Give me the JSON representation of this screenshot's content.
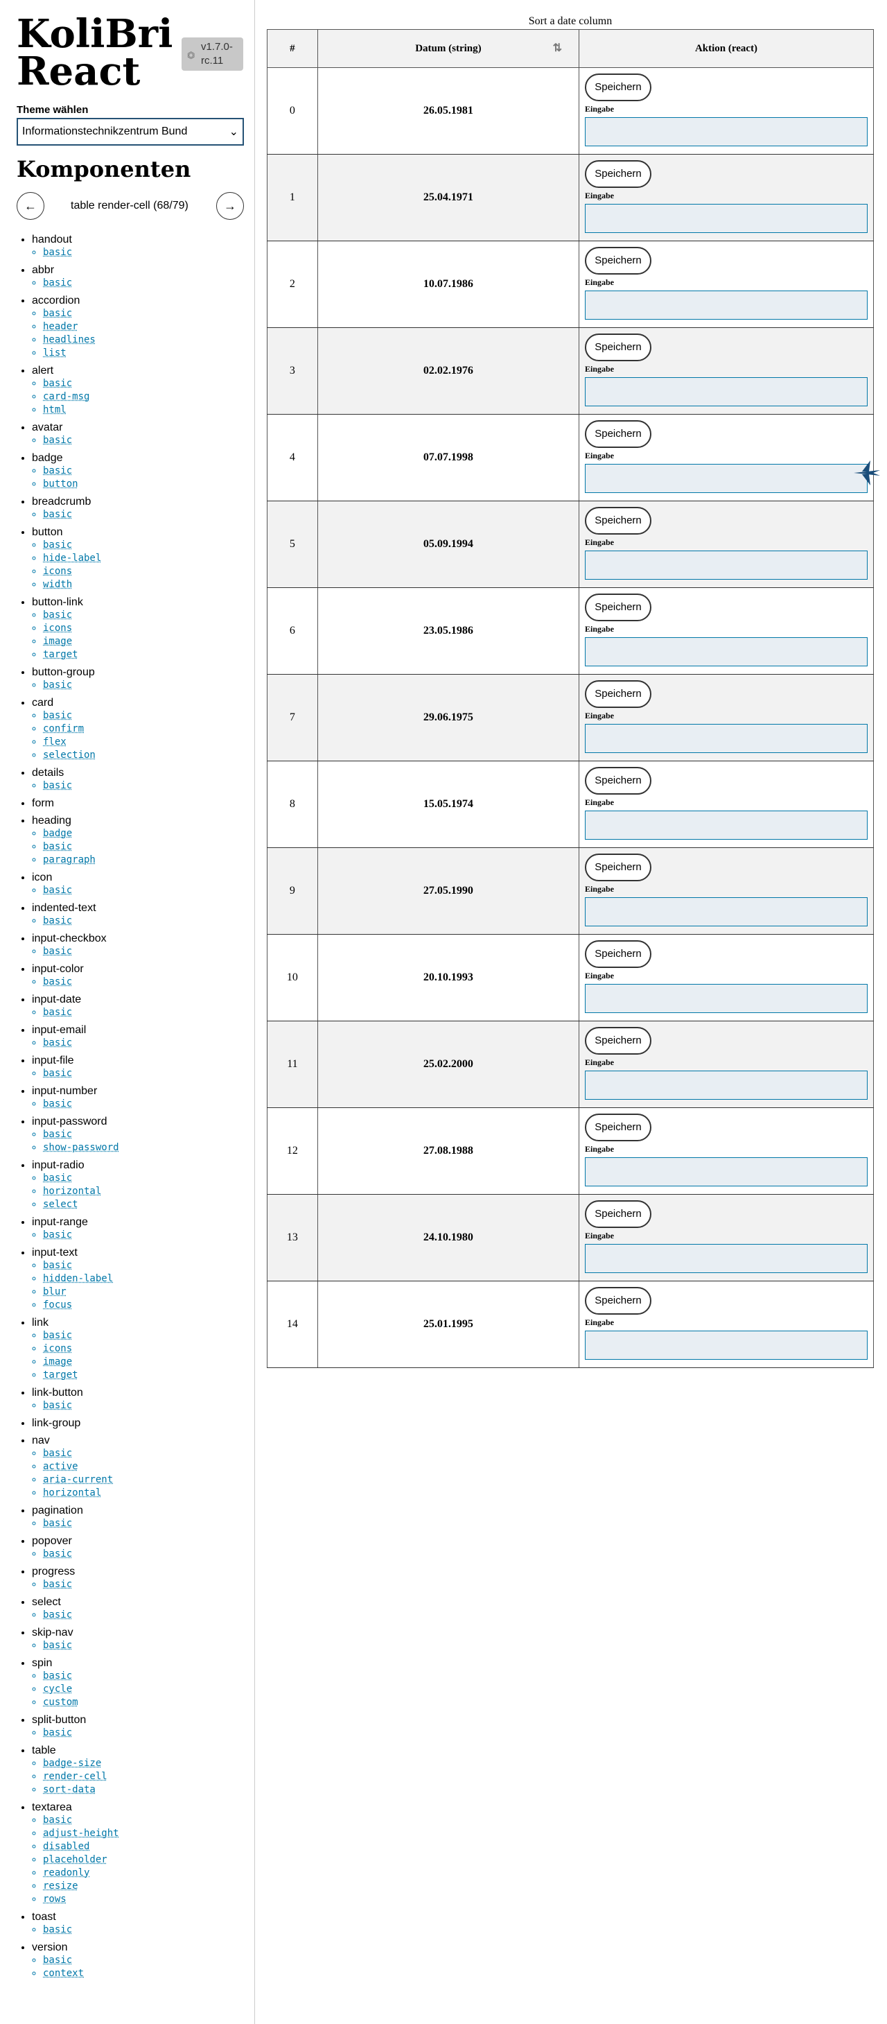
{
  "sidebar": {
    "logo_line1": "KoliBri",
    "logo_line2": "React",
    "version": "v1.7.0-rc.11",
    "theme_label": "Theme wählen",
    "theme_value": "Informationstechnikzentrum Bund",
    "components_heading": "Komponenten",
    "pager_label": "table render-cell (68/79)",
    "prev_icon": "arrow-left",
    "next_icon": "arrow-right",
    "components": [
      {
        "name": "handout",
        "links": [
          "basic"
        ]
      },
      {
        "name": "abbr",
        "links": [
          "basic"
        ]
      },
      {
        "name": "accordion",
        "links": [
          "basic",
          "header",
          "headlines",
          "list"
        ]
      },
      {
        "name": "alert",
        "links": [
          "basic",
          "card-msg",
          "html"
        ]
      },
      {
        "name": "avatar",
        "links": [
          "basic"
        ]
      },
      {
        "name": "badge",
        "links": [
          "basic",
          "button"
        ]
      },
      {
        "name": "breadcrumb",
        "links": [
          "basic"
        ]
      },
      {
        "name": "button",
        "links": [
          "basic",
          "hide-label",
          "icons",
          "width"
        ]
      },
      {
        "name": "button-link",
        "links": [
          "basic",
          "icons",
          "image",
          "target"
        ]
      },
      {
        "name": "button-group",
        "links": [
          "basic"
        ]
      },
      {
        "name": "card",
        "links": [
          "basic",
          "confirm",
          "flex",
          "selection"
        ]
      },
      {
        "name": "details",
        "links": [
          "basic"
        ]
      },
      {
        "name": "form",
        "links": []
      },
      {
        "name": "heading",
        "links": [
          "badge",
          "basic",
          "paragraph"
        ]
      },
      {
        "name": "icon",
        "links": [
          "basic"
        ]
      },
      {
        "name": "indented-text",
        "links": [
          "basic"
        ]
      },
      {
        "name": "input-checkbox",
        "links": [
          "basic"
        ]
      },
      {
        "name": "input-color",
        "links": [
          "basic"
        ]
      },
      {
        "name": "input-date",
        "links": [
          "basic"
        ]
      },
      {
        "name": "input-email",
        "links": [
          "basic"
        ]
      },
      {
        "name": "input-file",
        "links": [
          "basic"
        ]
      },
      {
        "name": "input-number",
        "links": [
          "basic"
        ]
      },
      {
        "name": "input-password",
        "links": [
          "basic",
          "show-password"
        ]
      },
      {
        "name": "input-radio",
        "links": [
          "basic",
          "horizontal",
          "select"
        ]
      },
      {
        "name": "input-range",
        "links": [
          "basic"
        ]
      },
      {
        "name": "input-text",
        "links": [
          "basic",
          "hidden-label",
          "blur",
          "focus"
        ]
      },
      {
        "name": "link",
        "links": [
          "basic",
          "icons",
          "image",
          "target"
        ]
      },
      {
        "name": "link-button",
        "links": [
          "basic"
        ]
      },
      {
        "name": "link-group",
        "links": []
      },
      {
        "name": "nav",
        "links": [
          "basic",
          "active",
          "aria-current",
          "horizontal"
        ]
      },
      {
        "name": "pagination",
        "links": [
          "basic"
        ]
      },
      {
        "name": "popover",
        "links": [
          "basic"
        ]
      },
      {
        "name": "progress",
        "links": [
          "basic"
        ]
      },
      {
        "name": "select",
        "links": [
          "basic"
        ]
      },
      {
        "name": "skip-nav",
        "links": [
          "basic"
        ]
      },
      {
        "name": "spin",
        "links": [
          "basic",
          "cycle",
          "custom"
        ]
      },
      {
        "name": "split-button",
        "links": [
          "basic"
        ]
      },
      {
        "name": "table",
        "links": [
          "badge-size",
          "render-cell",
          "sort-data"
        ]
      },
      {
        "name": "textarea",
        "links": [
          "basic",
          "adjust-height",
          "disabled",
          "placeholder",
          "readonly",
          "resize",
          "rows"
        ]
      },
      {
        "name": "toast",
        "links": [
          "basic"
        ]
      },
      {
        "name": "version",
        "links": [
          "basic",
          "context"
        ]
      }
    ]
  },
  "table": {
    "caption": "Sort a date column",
    "headers": [
      "#",
      "Datum (string)",
      "Aktion (react)"
    ],
    "save_label": "Speichern",
    "input_label": "Eingabe",
    "rows": [
      {
        "index": "0",
        "date": "26.05.1981"
      },
      {
        "index": "1",
        "date": "25.04.1971"
      },
      {
        "index": "2",
        "date": "10.07.1986"
      },
      {
        "index": "3",
        "date": "02.02.1976"
      },
      {
        "index": "4",
        "date": "07.07.1998"
      },
      {
        "index": "5",
        "date": "05.09.1994"
      },
      {
        "index": "6",
        "date": "23.05.1986"
      },
      {
        "index": "7",
        "date": "29.06.1975"
      },
      {
        "index": "8",
        "date": "15.05.1974"
      },
      {
        "index": "9",
        "date": "27.05.1990"
      },
      {
        "index": "10",
        "date": "20.10.1993"
      },
      {
        "index": "11",
        "date": "25.02.2000"
      },
      {
        "index": "12",
        "date": "27.08.1988"
      },
      {
        "index": "13",
        "date": "24.10.1980"
      },
      {
        "index": "14",
        "date": "25.01.1995"
      }
    ]
  },
  "colors": {
    "accent": "#0077a8",
    "header_bg": "#f2f2f2",
    "input_bg": "#e8eef3",
    "brand_dark": "#255275"
  }
}
